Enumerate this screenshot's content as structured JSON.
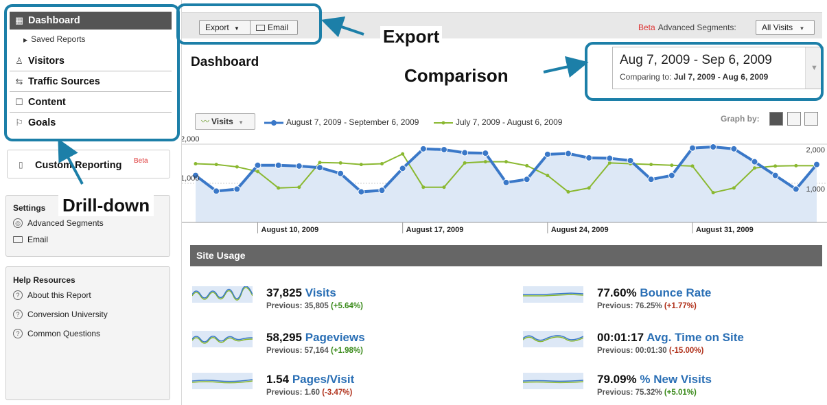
{
  "sidebar": {
    "nav": [
      {
        "label": "Dashboard",
        "icon": "dashboard-grid-icon"
      },
      {
        "label": "Visitors",
        "icon": "person-icon"
      },
      {
        "label": "Traffic Sources",
        "icon": "traffic-sign-icon"
      },
      {
        "label": "Content",
        "icon": "page-icon"
      },
      {
        "label": "Goals",
        "icon": "flag-icon"
      }
    ],
    "saved_reports": "Saved Reports",
    "custom_reporting": "Custom Reporting",
    "custom_beta": "Beta",
    "settings": {
      "title": "Settings",
      "items": [
        {
          "label": "Advanced Segments",
          "icon": "segments-icon"
        },
        {
          "label": "Email",
          "icon": "email-icon"
        }
      ]
    },
    "help": {
      "title": "Help Resources",
      "items": [
        {
          "label": "About this Report",
          "icon": "help-icon"
        },
        {
          "label": "Conversion University",
          "icon": "help-icon"
        },
        {
          "label": "Common Questions",
          "icon": "help-icon"
        }
      ]
    }
  },
  "toolbar": {
    "export_label": "Export",
    "email_label": "Email",
    "beta_label": "Beta",
    "segments_label": "Advanced Segments:",
    "segments_value": "All Visits"
  },
  "page_title": "Dashboard",
  "date_range": {
    "range": "Aug 7, 2009 - Sep 6, 2009",
    "compare_prefix": "Comparing to:",
    "compare_range": "Jul 7, 2009 - Aug 6, 2009"
  },
  "graph": {
    "metric_label": "Visits",
    "graph_by_label": "Graph by:"
  },
  "chart_data": {
    "type": "line",
    "x": [
      "2009-08-07",
      "2009-08-08",
      "2009-08-09",
      "2009-08-10",
      "2009-08-11",
      "2009-08-12",
      "2009-08-13",
      "2009-08-14",
      "2009-08-15",
      "2009-08-16",
      "2009-08-17",
      "2009-08-18",
      "2009-08-19",
      "2009-08-20",
      "2009-08-21",
      "2009-08-22",
      "2009-08-23",
      "2009-08-24",
      "2009-08-25",
      "2009-08-26",
      "2009-08-27",
      "2009-08-28",
      "2009-08-29",
      "2009-08-30",
      "2009-08-31",
      "2009-09-01",
      "2009-09-02",
      "2009-09-03",
      "2009-09-04",
      "2009-09-05",
      "2009-09-06"
    ],
    "x_tick_labels": [
      "August 10, 2009",
      "August 17, 2009",
      "August 24, 2009",
      "August 31, 2009"
    ],
    "y_tick_labels": [
      "2,000",
      "1,000"
    ],
    "ylim": [
      0,
      2000
    ],
    "series": [
      {
        "name": "August 7, 2009 - September 6, 2009",
        "color": "#3a78c8",
        "values": [
          1200,
          800,
          850,
          1460,
          1460,
          1440,
          1400,
          1250,
          780,
          820,
          1380,
          1880,
          1860,
          1780,
          1770,
          1020,
          1100,
          1740,
          1760,
          1650,
          1640,
          1580,
          1100,
          1200,
          1900,
          1930,
          1880,
          1550,
          1200,
          850,
          1480
        ]
      },
      {
        "name": "July 7, 2009 - August 6, 2009",
        "color": "#8ab830",
        "values": [
          1500,
          1480,
          1420,
          1300,
          880,
          900,
          1530,
          1520,
          1480,
          1500,
          1750,
          900,
          900,
          1520,
          1550,
          1550,
          1450,
          1200,
          780,
          880,
          1520,
          1500,
          1480,
          1460,
          1440,
          760,
          880,
          1390,
          1440,
          1450,
          1450
        ]
      }
    ],
    "grid": true
  },
  "site_usage": {
    "title": "Site Usage",
    "stats": [
      {
        "value": "37,825",
        "label": "Visits",
        "prev_prefix": "Previous:",
        "prev": "35,805",
        "change": "(+5.64%)",
        "trend": "pos"
      },
      {
        "value": "77.60%",
        "label": "Bounce Rate",
        "prev_prefix": "Previous:",
        "prev": "76.25%",
        "change": "(+1.77%)",
        "trend": "neg"
      },
      {
        "value": "58,295",
        "label": "Pageviews",
        "prev_prefix": "Previous:",
        "prev": "57,164",
        "change": "(+1.98%)",
        "trend": "pos"
      },
      {
        "value": "00:01:17",
        "label": "Avg. Time on Site",
        "prev_prefix": "Previous:",
        "prev": "00:01:30",
        "change": "(-15.00%)",
        "trend": "neg"
      },
      {
        "value": "1.54",
        "label": "Pages/Visit",
        "prev_prefix": "Previous:",
        "prev": "1.60",
        "change": "(-3.47%)",
        "trend": "neg"
      },
      {
        "value": "79.09%",
        "label": "% New Visits",
        "prev_prefix": "Previous:",
        "prev": "75.32%",
        "change": "(+5.01%)",
        "trend": "pos"
      }
    ]
  },
  "annotations": {
    "export": "Export",
    "comparison": "Comparison",
    "drilldown": "Drill-down"
  },
  "colors": {
    "accent": "#1c7fa8",
    "series_current": "#3a78c8",
    "series_previous": "#8ab830"
  }
}
